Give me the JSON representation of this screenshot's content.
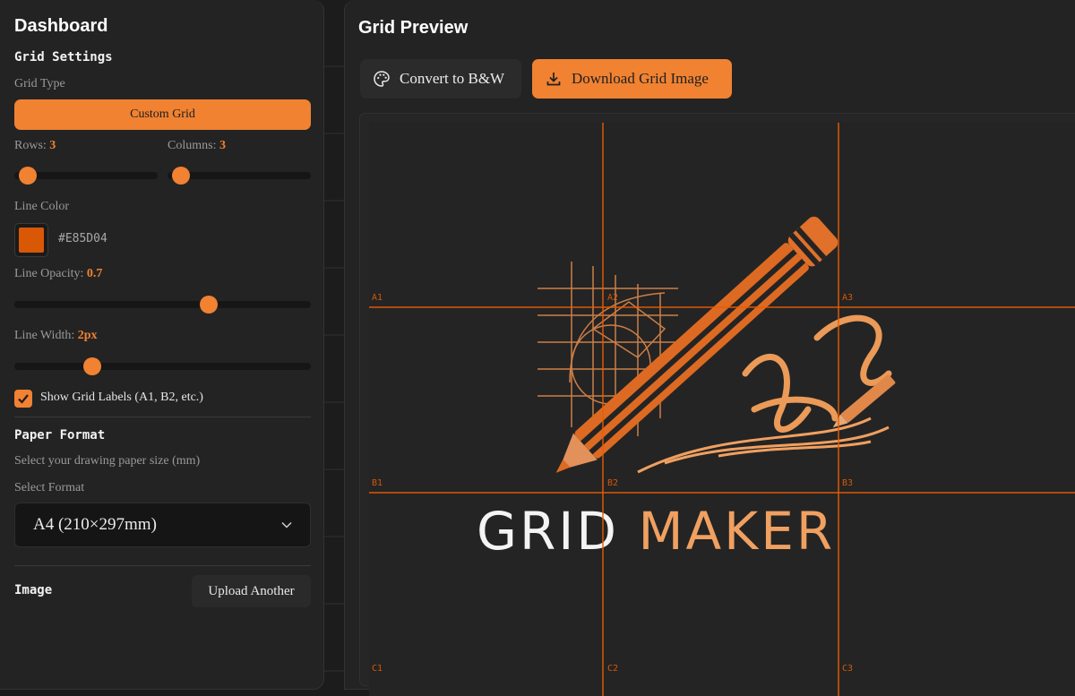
{
  "sidebar": {
    "title": "Dashboard",
    "grid_settings": {
      "heading": "Grid Settings",
      "grid_type_label": "Grid Type",
      "grid_type_value": "Custom Grid",
      "rows_label": "Rows:",
      "rows_value": "3",
      "columns_label": "Columns:",
      "columns_value": "3",
      "rows_slider_fraction": 0.08,
      "columns_slider_fraction": 0.08,
      "line_color_label": "Line Color",
      "line_color_hex": "#E85D04",
      "line_opacity_label": "Line Opacity:",
      "line_opacity_value": "0.7",
      "line_width_label": "Line Width:",
      "line_width_value": "2px",
      "show_labels_text": "Show Grid Labels (A1, B2, etc.)",
      "show_labels_checked": true
    },
    "paper_format": {
      "heading": "Paper Format",
      "description": "Select your drawing paper size (mm)",
      "select_label": "Select Format",
      "selected": "A4 (210×297mm)"
    },
    "image": {
      "heading": "Image",
      "upload_label": "Upload Another"
    }
  },
  "main": {
    "title": "Grid Preview",
    "convert_label": "Convert to B&W",
    "download_label": "Download Grid Image",
    "grid_labels": [
      "A1",
      "A2",
      "A3",
      "B1",
      "B2",
      "B3",
      "C1",
      "C2",
      "C3"
    ],
    "logo_word_1": "GRID",
    "logo_word_2": "MAKER"
  },
  "colors": {
    "accent": "#f08232",
    "grid_line": "#E85D04",
    "panel": "#232323",
    "background": "#1c1c1c"
  }
}
